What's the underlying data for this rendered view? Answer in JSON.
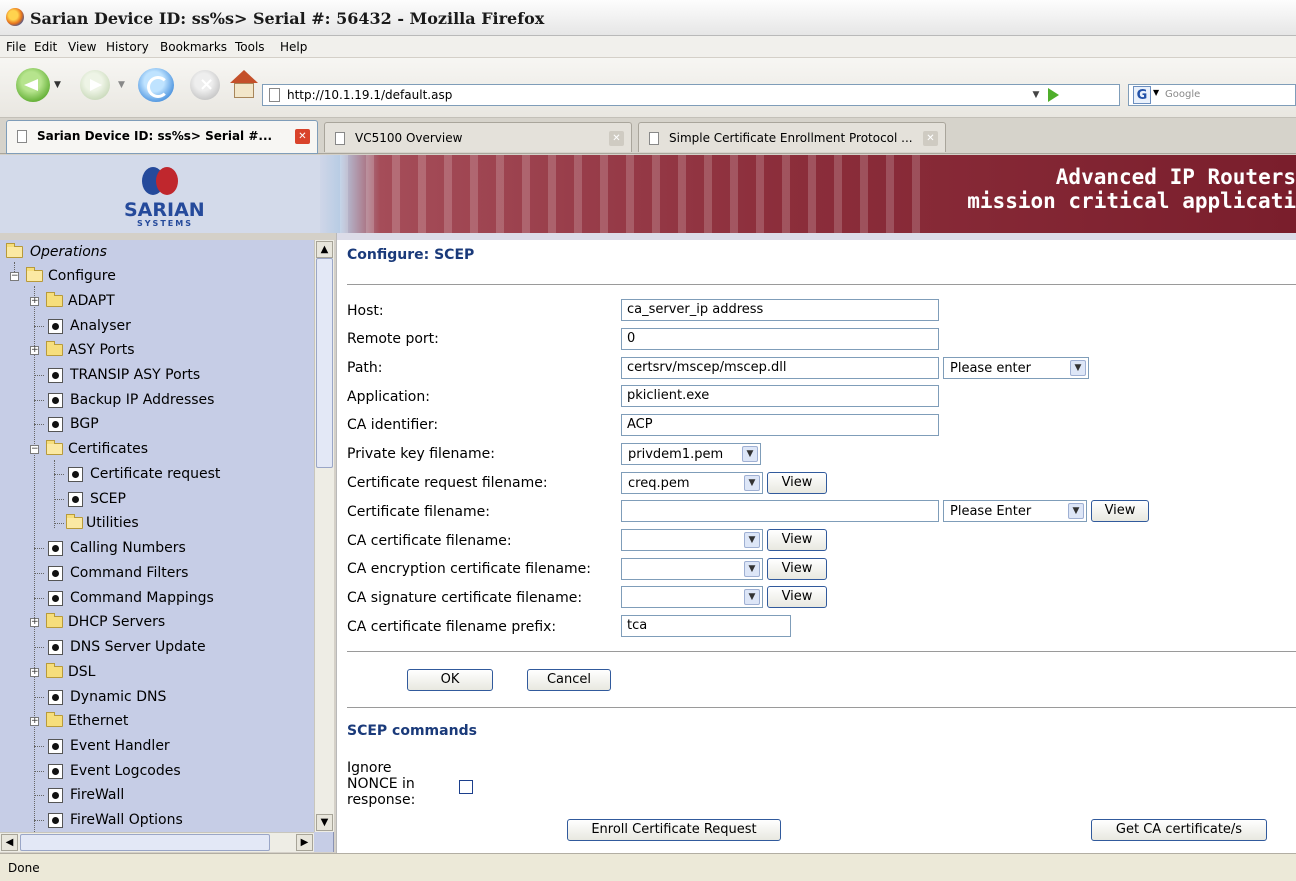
{
  "window": {
    "title": "Sarian Device ID: ss%s> Serial #: 56432 - Mozilla Firefox"
  },
  "menu": [
    "File",
    "Edit",
    "View",
    "History",
    "Bookmarks",
    "Tools",
    "Help"
  ],
  "toolbar": {
    "url": "http://10.1.19.1/default.asp",
    "search_placeholder": "Google",
    "search_engine_letter": "G"
  },
  "tabs": [
    {
      "label": "Sarian Device ID: ss%s> Serial #...",
      "selected": true
    },
    {
      "label": "VC5100 Overview",
      "selected": false
    },
    {
      "label": "Simple Certificate Enrollment Protocol ...",
      "selected": false
    }
  ],
  "banner": {
    "logo_text": "SARIAN",
    "logo_subtext": "SYSTEMS",
    "tagline_1": "Advanced IP Routers",
    "tagline_2": "mission critical applicati",
    "accent_color": "#8c2e3b",
    "logo_colors": [
      "#254a9b",
      "#c0272d"
    ]
  },
  "sidebar": {
    "items": [
      {
        "label": "Operations",
        "italic": true,
        "type": "folder-open",
        "level": 0
      },
      {
        "label": "Configure",
        "type": "folder-open",
        "level": 1,
        "toggle": "minus"
      },
      {
        "label": "ADAPT",
        "type": "folder",
        "level": 2,
        "toggle": "plus"
      },
      {
        "label": "Analyser",
        "type": "page",
        "level": 2
      },
      {
        "label": "ASY Ports",
        "type": "folder",
        "level": 2,
        "toggle": "plus"
      },
      {
        "label": "TRANSIP ASY Ports",
        "type": "page",
        "level": 2
      },
      {
        "label": "Backup IP Addresses",
        "type": "page",
        "level": 2
      },
      {
        "label": "BGP",
        "type": "page",
        "level": 2
      },
      {
        "label": "Certificates",
        "type": "folder-open",
        "level": 2,
        "toggle": "minus"
      },
      {
        "label": "Certificate request",
        "type": "page",
        "level": 3
      },
      {
        "label": "SCEP",
        "type": "page",
        "level": 3
      },
      {
        "label": "Utilities",
        "type": "folder-open",
        "level": 3
      },
      {
        "label": "Calling Numbers",
        "type": "page",
        "level": 2
      },
      {
        "label": "Command Filters",
        "type": "page",
        "level": 2
      },
      {
        "label": "Command Mappings",
        "type": "page",
        "level": 2
      },
      {
        "label": "DHCP Servers",
        "type": "folder",
        "level": 2,
        "toggle": "plus"
      },
      {
        "label": "DNS Server Update",
        "type": "page",
        "level": 2
      },
      {
        "label": "DSL",
        "type": "folder",
        "level": 2,
        "toggle": "plus"
      },
      {
        "label": "Dynamic DNS",
        "type": "page",
        "level": 2
      },
      {
        "label": "Ethernet",
        "type": "folder",
        "level": 2,
        "toggle": "plus"
      },
      {
        "label": "Event Handler",
        "type": "page",
        "level": 2
      },
      {
        "label": "Event Logcodes",
        "type": "page",
        "level": 2
      },
      {
        "label": "FireWall",
        "type": "page",
        "level": 2
      },
      {
        "label": "FireWall Options",
        "type": "page",
        "level": 2
      }
    ]
  },
  "form": {
    "heading": "Configure: SCEP",
    "fields": {
      "host": {
        "label": "Host:",
        "value": "ca_server_ip address"
      },
      "remote_port": {
        "label": "Remote port:",
        "value": "0"
      },
      "path": {
        "label": "Path:",
        "value": "certsrv/mscep/mscep.dll",
        "select": "Please enter"
      },
      "application": {
        "label": "Application:",
        "value": "pkiclient.exe"
      },
      "ca_identifier": {
        "label": "CA identifier:",
        "value": "ACP"
      },
      "private_key": {
        "label": "Private key filename:",
        "select": "privdem1.pem"
      },
      "cert_request": {
        "label": "Certificate request filename:",
        "select": "creq.pem",
        "button": "View"
      },
      "certificate": {
        "label": "Certificate filename:",
        "value": "",
        "select": "Please Enter",
        "button": "View"
      },
      "ca_cert": {
        "label": "CA certificate filename:",
        "select": "",
        "button": "View"
      },
      "ca_enc_cert": {
        "label": "CA encryption certificate filename:",
        "select": "",
        "button": "View"
      },
      "ca_sig_cert": {
        "label": "CA signature certificate filename:",
        "select": "",
        "button": "View"
      },
      "ca_cert_prefix": {
        "label": "CA certificate filename prefix:",
        "value": "tca"
      }
    },
    "ok_label": "OK",
    "cancel_label": "Cancel"
  },
  "scep": {
    "heading": "SCEP commands",
    "ignore_nonce_label": [
      "Ignore",
      "NONCE in",
      "response:"
    ],
    "ignore_nonce_checked": false,
    "enroll_label": "Enroll Certificate Request",
    "get_ca_label": "Get CA certificate/s"
  },
  "status": {
    "text": "Done"
  }
}
